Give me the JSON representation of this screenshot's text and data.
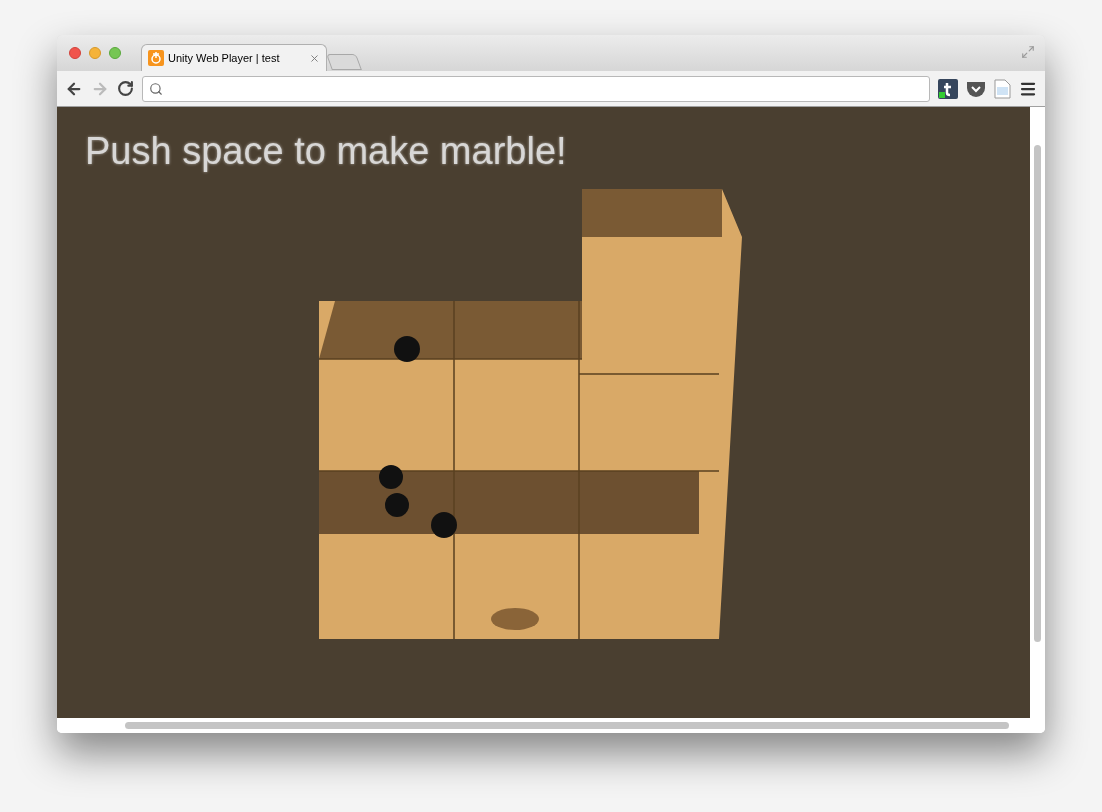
{
  "tabs": [
    {
      "title": "Unity Web Player | test",
      "selected": true
    }
  ],
  "toolbar": {
    "back": {
      "disabled": false
    },
    "forward": {
      "disabled": true
    }
  },
  "game": {
    "message": "Push space to make marble!"
  }
}
